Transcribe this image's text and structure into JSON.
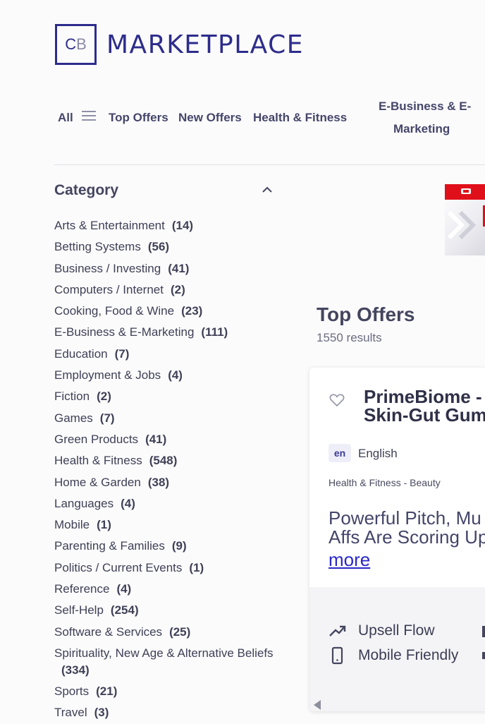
{
  "logo": {
    "mark_left": "C",
    "mark_right": "B",
    "text": "MARKETPLACE"
  },
  "nav": {
    "all": "All",
    "items": [
      "Top Offers",
      "New Offers",
      "Health & Fitness"
    ],
    "wrapped_line1": "E-Business & E-",
    "wrapped_line2": "Marketing"
  },
  "sidebar": {
    "title": "Category",
    "items": [
      {
        "label": "Arts & Entertainment",
        "count": "(14)"
      },
      {
        "label": "Betting Systems",
        "count": "(56)"
      },
      {
        "label": "Business / Investing",
        "count": "(41)"
      },
      {
        "label": "Computers / Internet",
        "count": "(2)"
      },
      {
        "label": "Cooking, Food & Wine",
        "count": "(23)"
      },
      {
        "label": "E-Business & E-Marketing",
        "count": "(111)"
      },
      {
        "label": "Education",
        "count": "(7)"
      },
      {
        "label": "Employment & Jobs",
        "count": "(4)"
      },
      {
        "label": "Fiction",
        "count": "(2)"
      },
      {
        "label": "Games",
        "count": "(7)"
      },
      {
        "label": "Green Products",
        "count": "(41)"
      },
      {
        "label": "Health & Fitness",
        "count": "(548)"
      },
      {
        "label": "Home & Garden",
        "count": "(38)"
      },
      {
        "label": "Languages",
        "count": "(4)"
      },
      {
        "label": "Mobile",
        "count": "(1)"
      },
      {
        "label": "Parenting & Families",
        "count": "(9)"
      },
      {
        "label": "Politics / Current Events",
        "count": "(1)"
      },
      {
        "label": "Reference",
        "count": "(4)"
      },
      {
        "label": "Self-Help",
        "count": "(254)"
      },
      {
        "label": "Software & Services",
        "count": "(25)"
      },
      {
        "label": "Spirituality, New Age & Alternative Beliefs",
        "count": "(334)"
      },
      {
        "label": "Sports",
        "count": "(21)"
      },
      {
        "label": "Travel",
        "count": "(3)"
      }
    ]
  },
  "main": {
    "title": "Top Offers",
    "results": "1550 results"
  },
  "card": {
    "title_line1": "PrimeBiome -",
    "title_line2": "Skin-Gut Gum",
    "lang_code": "en",
    "lang_name": "English",
    "category": "Health & Fitness - Beauty",
    "desc_line1": "Powerful Pitch, Mu",
    "desc_line2": "Affs Are Scoring Up",
    "more": "more",
    "features": [
      "Upsell Flow",
      "Mobile Friendly"
    ]
  },
  "colors": {
    "brand": "#2d2c8c",
    "link": "#2a28c9",
    "banner_red": "#e0101a"
  }
}
